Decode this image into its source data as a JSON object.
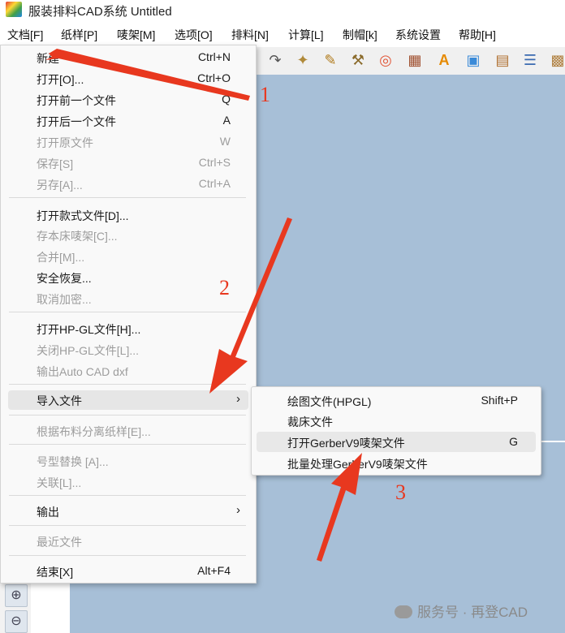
{
  "window": {
    "title": "服装排料CAD系统 Untitled"
  },
  "menubar": [
    {
      "label": "文档[F]"
    },
    {
      "label": "纸样[P]"
    },
    {
      "label": "唛架[M]"
    },
    {
      "label": "选项[O]"
    },
    {
      "label": "排料[N]"
    },
    {
      "label": "计算[L]"
    },
    {
      "label": "制帽[k]"
    },
    {
      "label": "系统设置"
    },
    {
      "label": "帮助[H]"
    }
  ],
  "file_menu": [
    {
      "label": "新建",
      "shortcut": "Ctrl+N"
    },
    {
      "label": "打开[O]...",
      "shortcut": "Ctrl+O"
    },
    {
      "label": "打开前一个文件",
      "shortcut": "Q"
    },
    {
      "label": "打开后一个文件",
      "shortcut": "A"
    },
    {
      "label": "打开原文件",
      "shortcut": "W"
    },
    {
      "label": "保存[S]",
      "shortcut": "Ctrl+S"
    },
    {
      "label": "另存[A]...",
      "shortcut": "Ctrl+A"
    },
    {
      "label": "打开款式文件[D]..."
    },
    {
      "label": "存本床唛架[C]..."
    },
    {
      "label": "合并[M]..."
    },
    {
      "label": "安全恢复..."
    },
    {
      "label": "取消加密..."
    },
    {
      "label": "打开HP-GL文件[H]..."
    },
    {
      "label": "关闭HP-GL文件[L]..."
    },
    {
      "label": "输出Auto CAD dxf"
    },
    {
      "label": "导入文件"
    },
    {
      "label": "根据布料分离纸样[E]..."
    },
    {
      "label": "号型替换 [A]..."
    },
    {
      "label": "关联[L]..."
    },
    {
      "label": "输出"
    },
    {
      "label": "最近文件"
    },
    {
      "label": "结束[X]",
      "shortcut": "Alt+F4"
    }
  ],
  "import_submenu": [
    {
      "label": "绘图文件(HPGL)",
      "shortcut": "Shift+P"
    },
    {
      "label": "裁床文件"
    },
    {
      "label": "打开GerberV9唛架文件",
      "shortcut": "G"
    },
    {
      "label": "批量处理GerberV9唛架文件"
    }
  ],
  "annotations": {
    "step1": "1",
    "step2": "2",
    "step3": "3",
    "arrow_color": "#e8381f"
  },
  "toolbar_icons": [
    "redo-arrow-icon",
    "fish-icon",
    "measure-icon",
    "wrench-icon",
    "ring-icon",
    "grid-icon",
    "letter-a-icon",
    "image-icon",
    "layers-icon",
    "list-icon",
    "pattern-icon"
  ],
  "watermark": {
    "text": "服务号 · 再登CAD"
  },
  "colors": {
    "canvas": "#a7bfd7",
    "menu_bg": "#f9f9f9",
    "disabled_text": "#9d9d9d"
  }
}
